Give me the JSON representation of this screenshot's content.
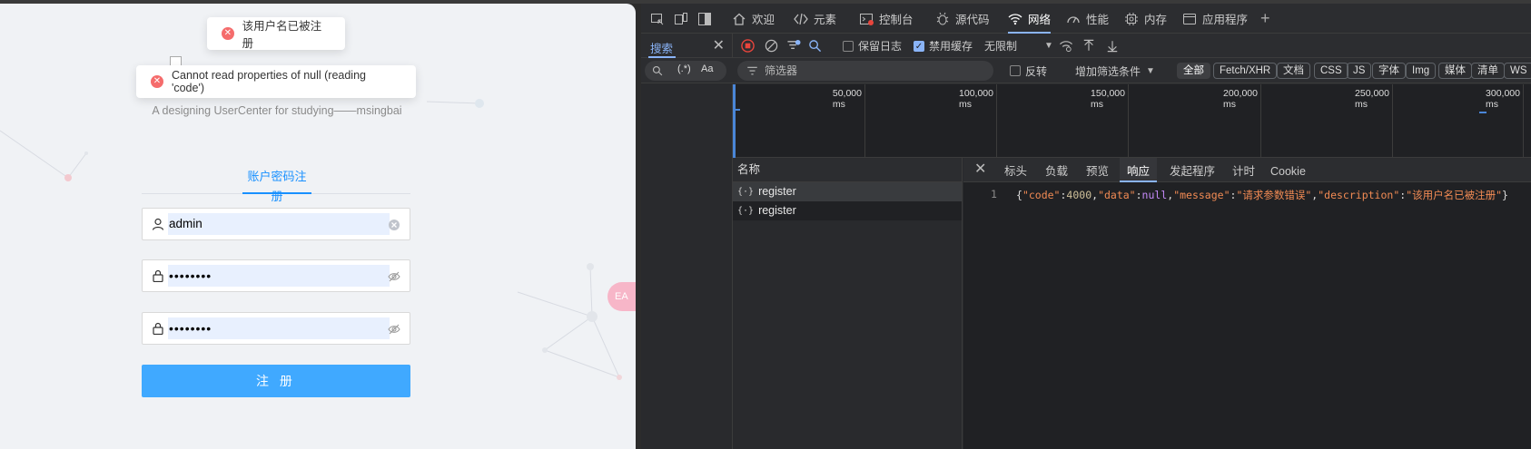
{
  "page": {
    "toasts": [
      {
        "text": "该用户名已被注册"
      },
      {
        "text": "Cannot read properties of null (reading 'code')"
      }
    ],
    "subtitle": "A designing UserCenter for studying——msingbai",
    "tab_label": "账户密码注册",
    "username_value": "admin",
    "password_value": "••••••••",
    "confirm_value": "••••••••",
    "submit_label": "注 册",
    "float_tab_label": "EA"
  },
  "devtools": {
    "main_tabs": [
      {
        "label": "欢迎",
        "icon": "home-icon"
      },
      {
        "label": "元素",
        "icon": "code-icon"
      },
      {
        "label": "控制台",
        "icon": "console-icon"
      },
      {
        "label": "源代码",
        "icon": "bug-icon"
      },
      {
        "label": "网络",
        "icon": "wifi-icon"
      },
      {
        "label": "性能",
        "icon": "gauge-icon"
      },
      {
        "label": "内存",
        "icon": "chip-icon"
      },
      {
        "label": "应用程序",
        "icon": "app-icon"
      }
    ],
    "active_tab": "网络",
    "search_tab_label": "搜索",
    "preserve_log_label": "保留日志",
    "disable_cache_label": "禁用缓存",
    "throttle_label": "无限制",
    "search_regex_label": "(.*)",
    "search_case_label": "Aa",
    "filter_placeholder": "筛选器",
    "invert_label": "反转",
    "more_filters_label": "增加筛选条件",
    "filter_chips": [
      "全部",
      "Fetch/XHR",
      "文档",
      "CSS",
      "JS",
      "字体",
      "Img",
      "媒体",
      "清单",
      "WS"
    ],
    "timeline_labels": [
      "50,000 ms",
      "100,000 ms",
      "150,000 ms",
      "200,000 ms",
      "250,000 ms",
      "300,000 ms"
    ],
    "name_header": "名称",
    "requests": [
      {
        "name": "register"
      },
      {
        "name": "register"
      }
    ],
    "detail_tabs": [
      "标头",
      "负载",
      "预览",
      "响应",
      "发起程序",
      "计时",
      "Cookie"
    ],
    "active_detail_tab": "响应",
    "response_line_number": "1",
    "response": {
      "code_key": "\"code\"",
      "code_val": "4000",
      "data_key": "\"data\"",
      "data_val": "null",
      "message_key": "\"message\"",
      "message_val": "\"请求参数错误\"",
      "description_key": "\"description\"",
      "description_val": "\"该用户名已被注册\""
    },
    "accent_color": "#8ab4f8"
  }
}
